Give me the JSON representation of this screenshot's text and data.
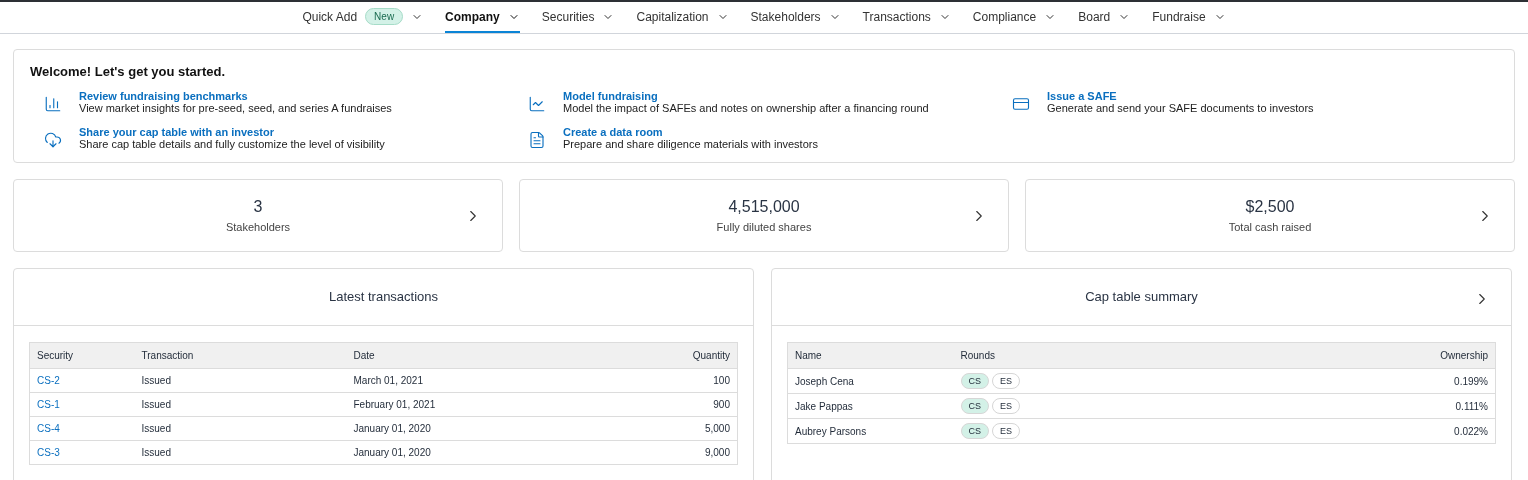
{
  "nav": {
    "items": [
      {
        "label": "Quick Add",
        "badge": "New",
        "selected": false
      },
      {
        "label": "Company",
        "selected": true
      },
      {
        "label": "Securities",
        "selected": false
      },
      {
        "label": "Capitalization",
        "selected": false
      },
      {
        "label": "Stakeholders",
        "selected": false
      },
      {
        "label": "Transactions",
        "selected": false
      },
      {
        "label": "Compliance",
        "selected": false
      },
      {
        "label": "Board",
        "selected": false
      },
      {
        "label": "Fundraise",
        "selected": false
      }
    ]
  },
  "welcome": {
    "title": "Welcome! Let's get you started.",
    "actions": [
      {
        "kind": "benchmarks",
        "title": "Review fundraising benchmarks",
        "description": "View market insights for pre-seed, seed, and series A fundraises"
      },
      {
        "kind": "model",
        "title": "Model fundraising",
        "description": "Model the impact of SAFEs and notes on ownership after a financing round"
      },
      {
        "kind": "safe",
        "title": "Issue a SAFE",
        "description": "Generate and send your SAFE documents to investors"
      },
      {
        "kind": "share",
        "title": "Share your cap table with an investor",
        "description": "Share cap table details and fully customize the level of visibility"
      },
      {
        "kind": "dataroom",
        "title": "Create a data room",
        "description": "Prepare and share diligence materials with investors"
      }
    ]
  },
  "stats": [
    {
      "value": "3",
      "label": "Stakeholders"
    },
    {
      "value": "4,515,000",
      "label": "Fully diluted shares"
    },
    {
      "value": "$2,500",
      "label": "Total cash raised"
    }
  ],
  "latest_transactions": {
    "title": "Latest transactions",
    "columns": [
      "Security",
      "Transaction",
      "Date",
      "Quantity"
    ],
    "rows": [
      [
        "CS-2",
        "Issued",
        "March 01, 2021",
        "100"
      ],
      [
        "CS-1",
        "Issued",
        "February 01, 2021",
        "900"
      ],
      [
        "CS-4",
        "Issued",
        "January 01, 2020",
        "5,000"
      ],
      [
        "CS-3",
        "Issued",
        "January 01, 2020",
        "9,000"
      ]
    ]
  },
  "cap_table_summary": {
    "title": "Cap table summary",
    "columns": [
      "Name",
      "Rounds",
      "Ownership"
    ],
    "rows": [
      {
        "name": "Joseph Cena",
        "rounds": [
          {
            "label": "CS",
            "color": "#d3f1e7"
          },
          {
            "label": "ES",
            "color": "#ffffff"
          }
        ],
        "ownership": "0.199%"
      },
      {
        "name": "Jake Pappas",
        "rounds": [
          {
            "label": "CS",
            "color": "#d3f1e7"
          },
          {
            "label": "ES",
            "color": "#ffffff"
          }
        ],
        "ownership": "0.111%"
      },
      {
        "name": "Aubrey Parsons",
        "rounds": [
          {
            "label": "CS",
            "color": "#d3f1e7"
          },
          {
            "label": "ES",
            "color": "#ffffff"
          }
        ],
        "ownership": "0.022%"
      }
    ]
  }
}
